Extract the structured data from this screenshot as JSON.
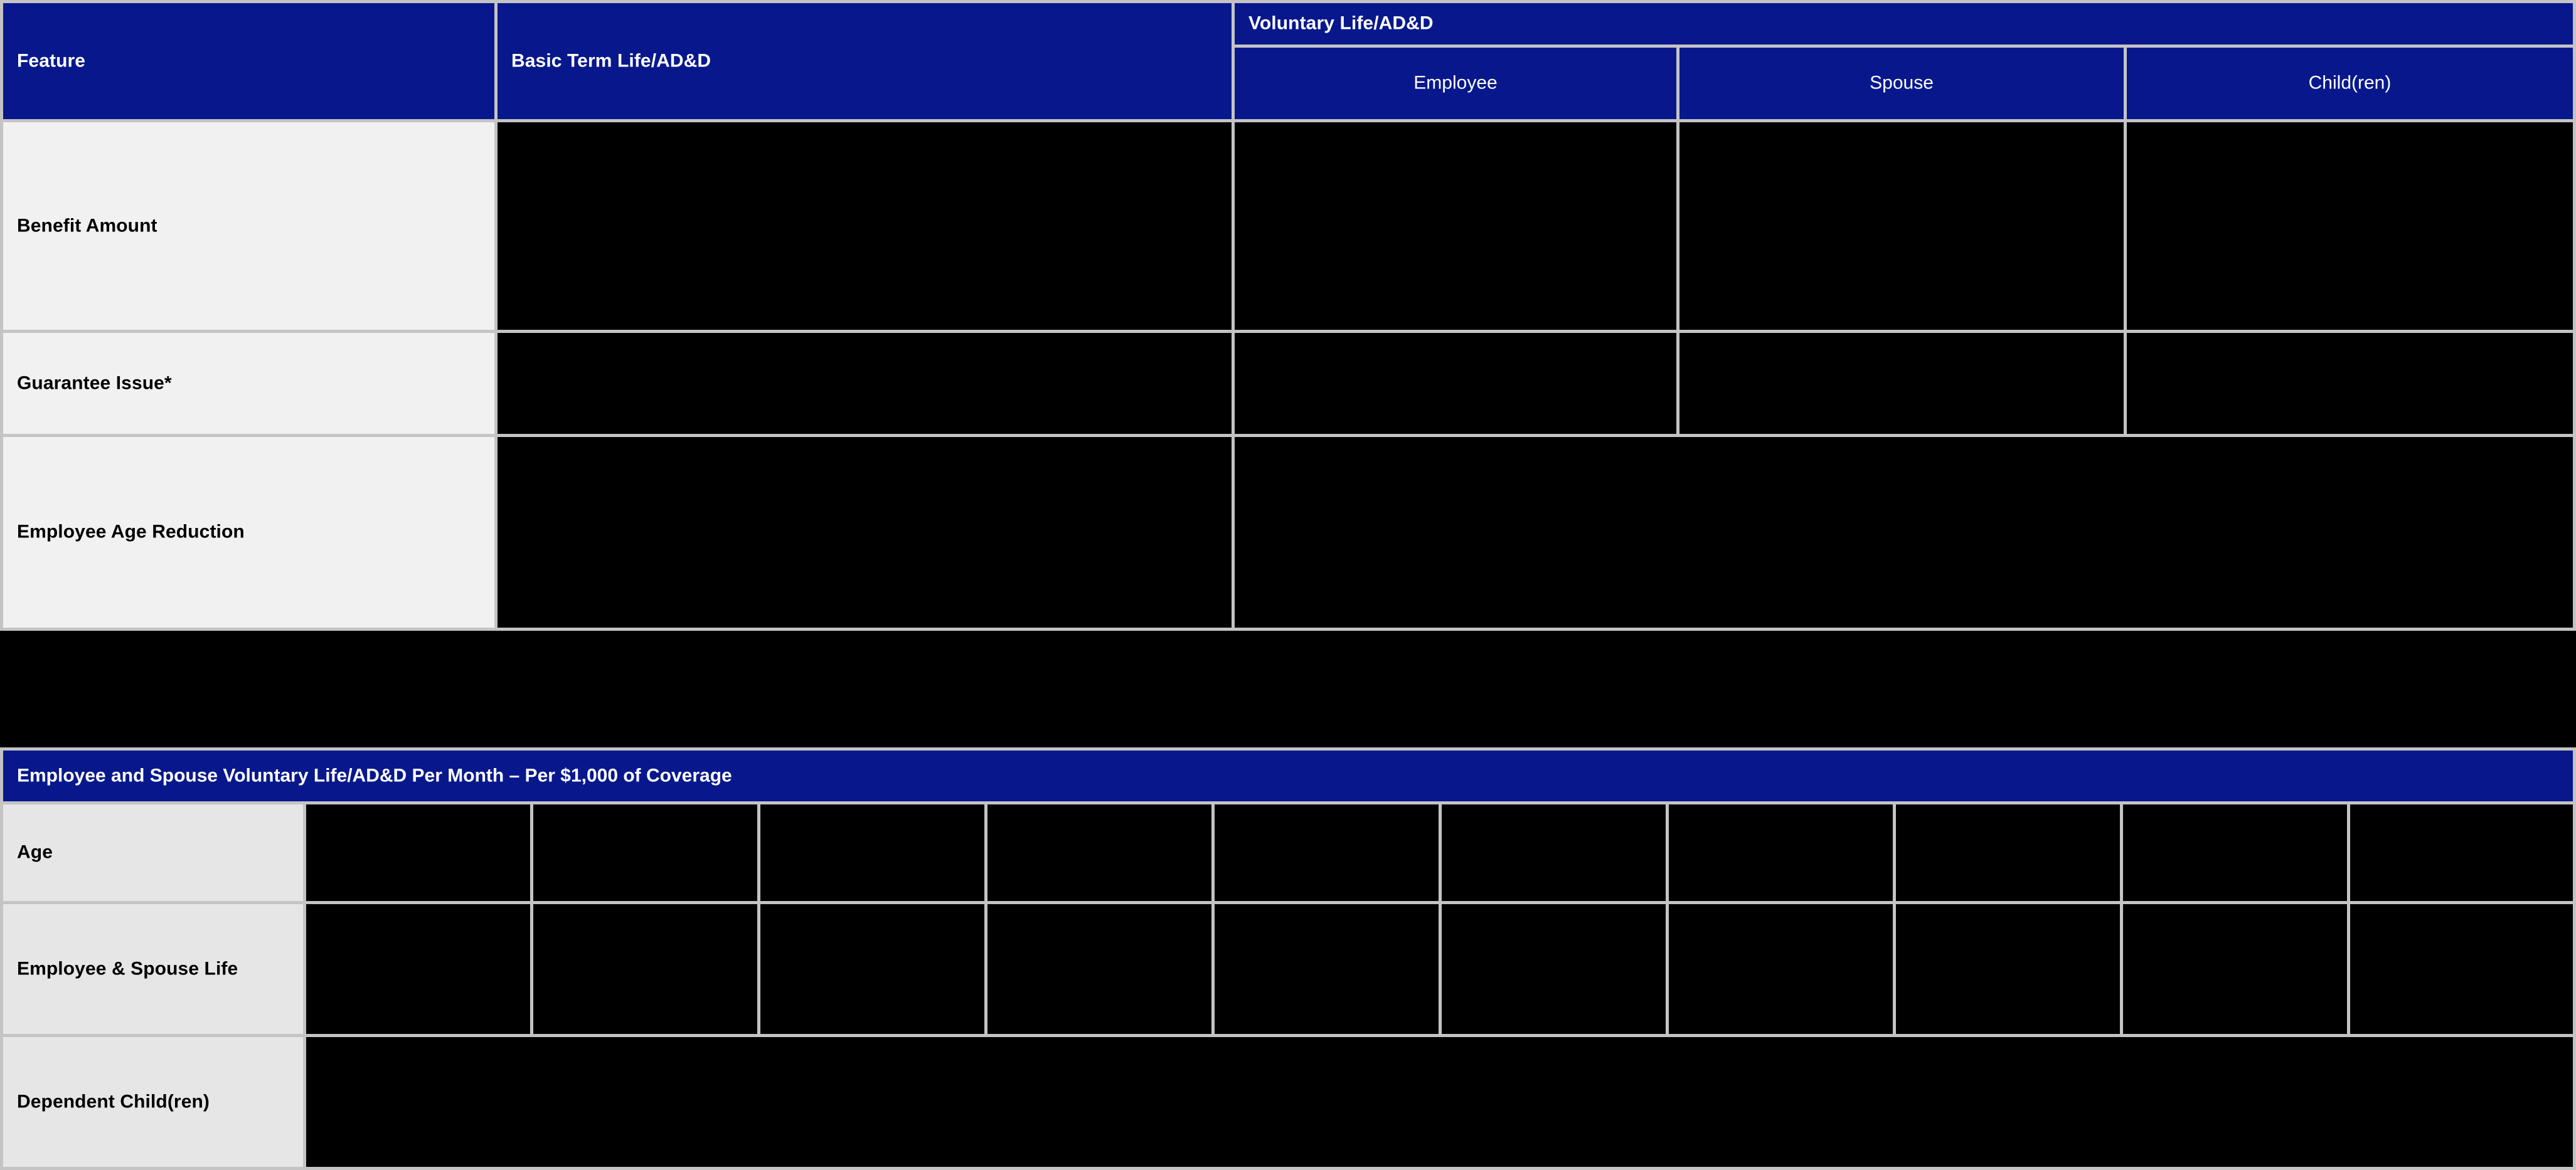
{
  "colors": {
    "header_blue": "#08188c",
    "gridline": "#c4c4c4",
    "label_cell": "#f1f1f1",
    "label_cell_alt": "#e6e6e6",
    "data_cell": "#000000",
    "header_text": "#ffffff",
    "label_text": "#000000",
    "page_background": "#000000"
  },
  "benefit_comparison_table": {
    "headers": {
      "feature": "Feature",
      "basic": "Basic Term Life/AD&D",
      "voluntary": "Voluntary Life/AD&D",
      "voluntary_sub": [
        "Employee",
        "Spouse",
        "Child(ren)"
      ]
    },
    "rows": [
      {
        "label": "Benefit Amount",
        "basic": "",
        "employee": "",
        "spouse": "",
        "children": "",
        "merged_voluntary": false
      },
      {
        "label": "Guarantee Issue*",
        "basic": "",
        "employee": "",
        "spouse": "",
        "children": "",
        "merged_voluntary": false
      },
      {
        "label": "Employee Age Reduction",
        "basic": "",
        "voluntary_merged": "",
        "merged_voluntary": true
      }
    ]
  },
  "rate_table": {
    "title": "Employee and Spouse Voluntary Life/AD&D Per Month – Per $1,000 of Coverage",
    "column_count": 10,
    "rows": [
      {
        "label": "Age",
        "values": [
          "",
          "",
          "",
          "",
          "",
          "",
          "",
          "",
          "",
          ""
        ],
        "merged": false
      },
      {
        "label": "Employee & Spouse Life",
        "values": [
          "",
          "",
          "",
          "",
          "",
          "",
          "",
          "",
          "",
          ""
        ],
        "merged": false
      },
      {
        "label": "Dependent Child(ren)",
        "values": [
          ""
        ],
        "merged": true
      }
    ]
  }
}
